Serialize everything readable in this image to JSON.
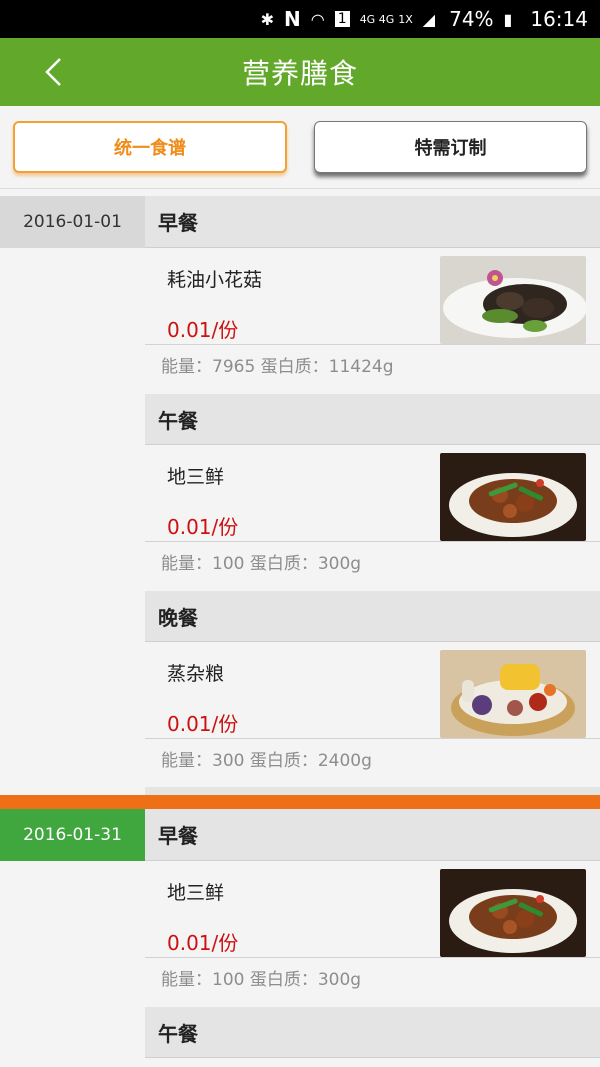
{
  "status_bar": {
    "network": "4G 4G",
    "network_sub": "1X",
    "battery": "74%",
    "time": "16:14"
  },
  "header": {
    "title": "营养膳食"
  },
  "tabs": [
    {
      "label": "统一食谱",
      "active": true
    },
    {
      "label": "特需订制",
      "active": false
    }
  ],
  "days": [
    {
      "date": "2016-01-01",
      "meals": [
        {
          "type": "早餐",
          "dish": "耗油小花菇",
          "price": "0.01/份",
          "nutrition": "能量：7965  蛋白质：11424g"
        },
        {
          "type": "午餐",
          "dish": "地三鲜",
          "price": "0.01/份",
          "nutrition": "能量：100  蛋白质：300g"
        },
        {
          "type": "晚餐",
          "dish": "蒸杂粮",
          "price": "0.01/份",
          "nutrition": "能量：300  蛋白质：2400g"
        }
      ]
    },
    {
      "date": "2016-01-31",
      "meals": [
        {
          "type": "早餐",
          "dish": "地三鲜",
          "price": "0.01/份",
          "nutrition": "能量：100  蛋白质：300g"
        },
        {
          "type": "午餐"
        }
      ]
    }
  ],
  "colors": {
    "header_green": "#62a82a",
    "active_tab_orange": "#f08c1a",
    "price_red": "#cc1111",
    "date_green": "#3fa73d",
    "separator_orange": "#ef6f17"
  }
}
